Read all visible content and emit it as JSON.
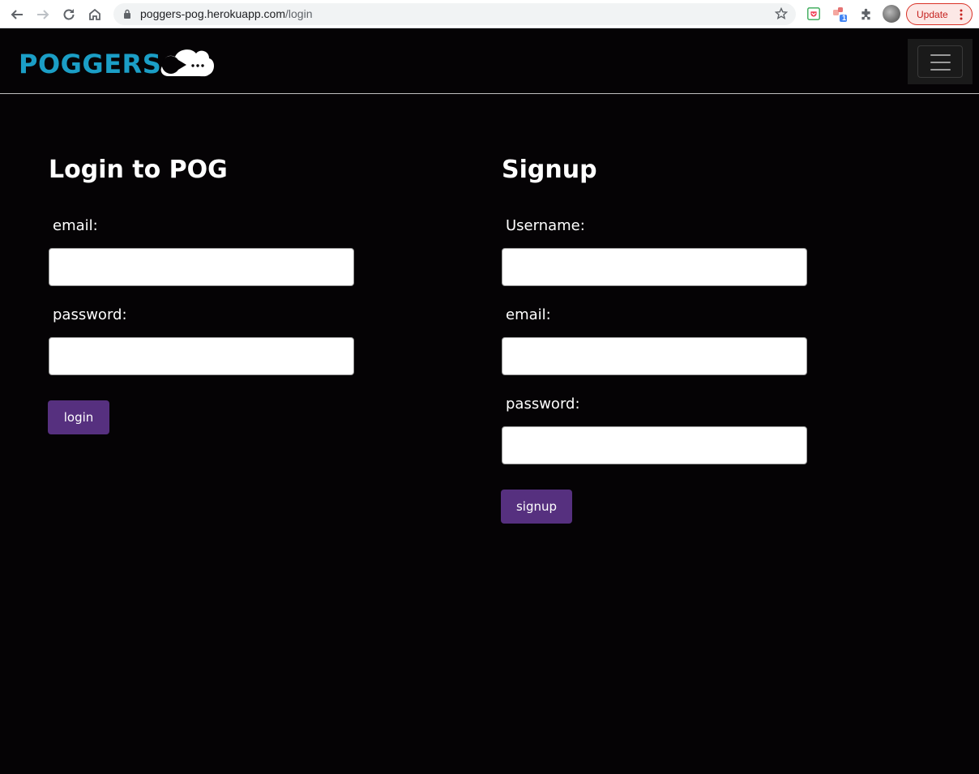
{
  "browser": {
    "url_host": "poggers-pog.herokuapp.com",
    "url_path": "/login",
    "update_label": "Update",
    "extension_badge": "1"
  },
  "navbar": {
    "brand": "POGGERS"
  },
  "login": {
    "title": "Login to POG",
    "email_label": "email:",
    "password_label": "password:",
    "button_label": "login"
  },
  "signup": {
    "title": "Signup",
    "username_label": "Username:",
    "email_label": "email:",
    "password_label": "password:",
    "button_label": "signup"
  },
  "colors": {
    "background": "#050305",
    "brand": "#1b9ec6",
    "button": "#56307f"
  }
}
